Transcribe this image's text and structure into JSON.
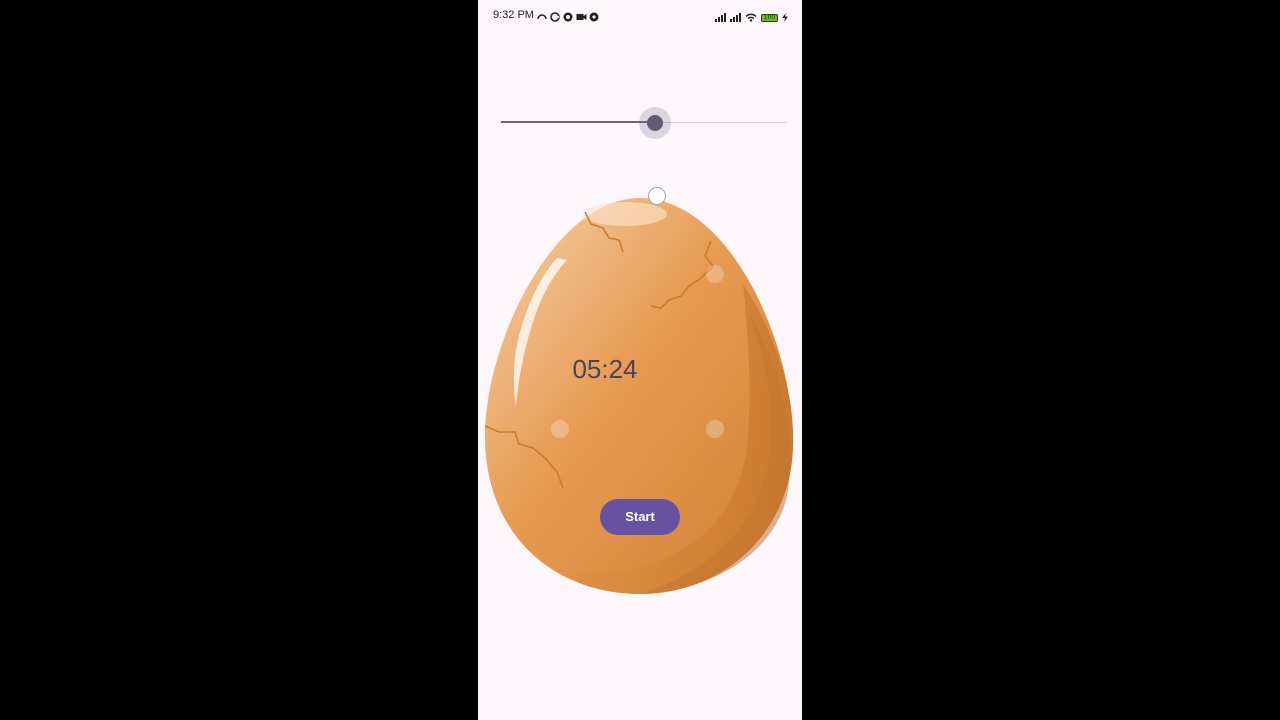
{
  "status_bar": {
    "time": "9:32 PM",
    "battery_level": "100",
    "left_icons": [
      "sync-icon",
      "circle-c-icon",
      "notification-icon",
      "video-icon",
      "app-icon"
    ],
    "right_icons": [
      "signal-icon",
      "signal-icon",
      "wifi-icon",
      "battery-icon",
      "charging-icon"
    ]
  },
  "slider": {
    "value_fraction": 0.54
  },
  "timer": {
    "display": "05:24"
  },
  "egg": {
    "image": "cracked-egg-illustration"
  },
  "start_button": {
    "label": "Start"
  },
  "colors": {
    "background": "#fdf7fc",
    "accent": "#6553a2",
    "slider_thumb": "#625b71",
    "timer_text": "#4a4458"
  }
}
